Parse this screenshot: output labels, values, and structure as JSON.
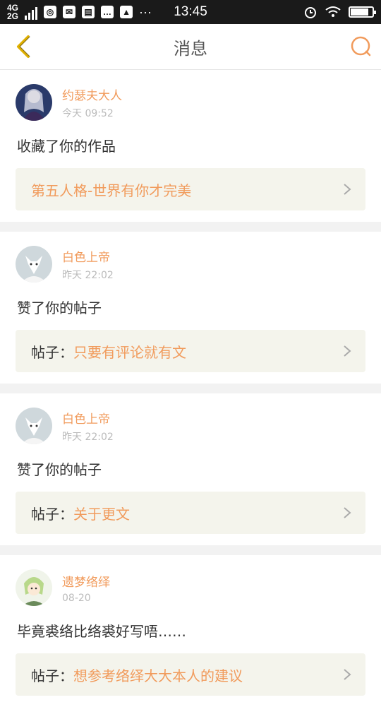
{
  "status": {
    "network_top": "4G",
    "network_bottom": "2G",
    "time": "13:45",
    "dots": "···"
  },
  "header": {
    "title": "消息"
  },
  "colors": {
    "accent": "#f19b5c",
    "back": "#e0b000"
  },
  "messages": [
    {
      "user": "约瑟夫大人",
      "time": "今天 09:52",
      "action": "收藏了你的作品",
      "link_label": "",
      "link_value": "第五人格-世界有你才完美",
      "avatar": "dark-haired-character-avatar"
    },
    {
      "user": "白色上帝",
      "time": "昨天 22:02",
      "action": "赞了你的帖子",
      "link_label": "帖子：",
      "link_value": "只要有评论就有文",
      "avatar": "white-wolf-avatar"
    },
    {
      "user": "白色上帝",
      "time": "昨天 22:02",
      "action": "赞了你的帖子",
      "link_label": "帖子：",
      "link_value": "关于更文",
      "avatar": "white-wolf-avatar"
    },
    {
      "user": "遗梦络绎",
      "time": "08-20",
      "action": "毕竟裘络比络裘好写唔……",
      "link_label": "帖子：",
      "link_value": "想参考络绎大大本人的建议",
      "avatar": "green-hair-character-avatar"
    }
  ]
}
